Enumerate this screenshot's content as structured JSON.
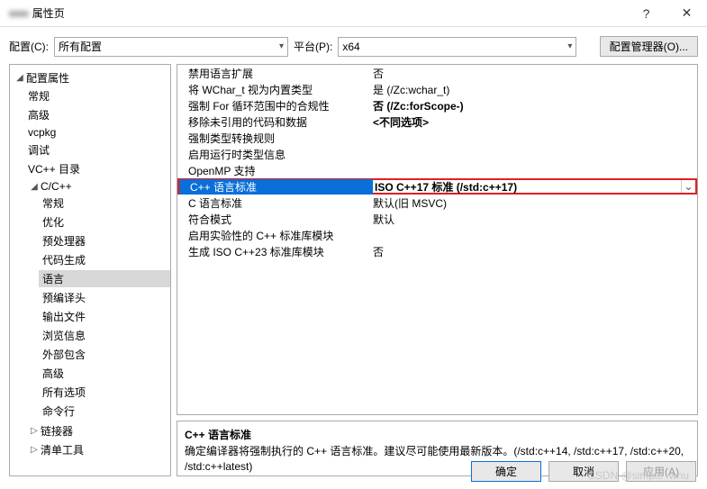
{
  "titlebar": {
    "blur": "■■■",
    "title": "属性页",
    "help": "?",
    "close": "✕"
  },
  "labels": {
    "config": "配置(C):",
    "platform": "平台(P):",
    "cfgmgr": "配置管理器(O)..."
  },
  "combos": {
    "config": "所有配置",
    "platform": "x64"
  },
  "tree": {
    "root": "配置属性",
    "items": [
      "常规",
      "高级",
      "vcpkg",
      "调试",
      "VC++ 目录"
    ],
    "cc": "C/C++",
    "ccitems": [
      "常规",
      "优化",
      "预处理器",
      "代码生成",
      "语言",
      "预编译头",
      "输出文件",
      "浏览信息",
      "外部包含",
      "高级",
      "所有选项",
      "命令行"
    ],
    "linker": "链接器",
    "manifest": "清单工具"
  },
  "grid": [
    {
      "name": "禁用语言扩展",
      "val": "否"
    },
    {
      "name": "将 WChar_t 视为内置类型",
      "val": "是 (/Zc:wchar_t)"
    },
    {
      "name": "强制 For 循环范围中的合规性",
      "val": "否 (/Zc:forScope-)",
      "bold": true
    },
    {
      "name": "移除未引用的代码和数据",
      "val": "<不同选项>",
      "bold": true
    },
    {
      "name": "强制类型转换规则",
      "val": ""
    },
    {
      "name": "启用运行时类型信息",
      "val": ""
    },
    {
      "name": "OpenMP 支持",
      "val": ""
    },
    {
      "name": "C++ 语言标准",
      "val": "ISO C++17 标准 (/std:c++17)",
      "hl": true
    },
    {
      "name": "C 语言标准",
      "val": "默认(旧 MSVC)"
    },
    {
      "name": "符合模式",
      "val": "默认"
    },
    {
      "name": "启用实验性的 C++ 标准库模块",
      "val": ""
    },
    {
      "name": "生成 ISO C++23 标准库模块",
      "val": "否"
    }
  ],
  "desc": {
    "title": "C++ 语言标准",
    "body": "确定编译器将强制执行的 C++ 语言标准。建议尽可能使用最新版本。(/std:c++14, /std:c++17, /std:c++20, /std:c++latest)"
  },
  "buttons": {
    "ok": "确定",
    "cancel": "取消",
    "apply": "应用(A)"
  },
  "watermark": "CSDN @simple_whu"
}
